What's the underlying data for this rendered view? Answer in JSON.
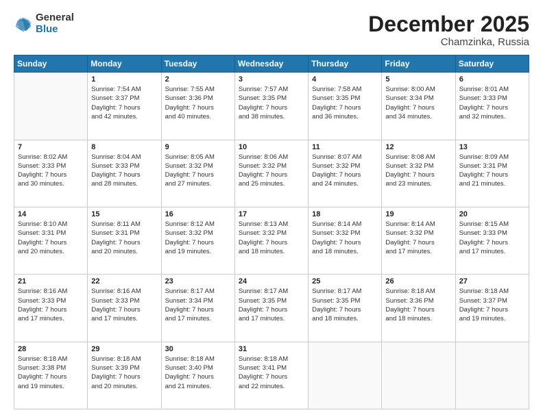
{
  "logo": {
    "general": "General",
    "blue": "Blue"
  },
  "header": {
    "month": "December 2025",
    "location": "Chamzinka, Russia"
  },
  "weekdays": [
    "Sunday",
    "Monday",
    "Tuesday",
    "Wednesday",
    "Thursday",
    "Friday",
    "Saturday"
  ],
  "weeks": [
    [
      {
        "day": "",
        "sunrise": "",
        "sunset": "",
        "daylight1": "",
        "daylight2": ""
      },
      {
        "day": "1",
        "sunrise": "Sunrise: 7:54 AM",
        "sunset": "Sunset: 3:37 PM",
        "daylight1": "Daylight: 7 hours",
        "daylight2": "and 42 minutes."
      },
      {
        "day": "2",
        "sunrise": "Sunrise: 7:55 AM",
        "sunset": "Sunset: 3:36 PM",
        "daylight1": "Daylight: 7 hours",
        "daylight2": "and 40 minutes."
      },
      {
        "day": "3",
        "sunrise": "Sunrise: 7:57 AM",
        "sunset": "Sunset: 3:35 PM",
        "daylight1": "Daylight: 7 hours",
        "daylight2": "and 38 minutes."
      },
      {
        "day": "4",
        "sunrise": "Sunrise: 7:58 AM",
        "sunset": "Sunset: 3:35 PM",
        "daylight1": "Daylight: 7 hours",
        "daylight2": "and 36 minutes."
      },
      {
        "day": "5",
        "sunrise": "Sunrise: 8:00 AM",
        "sunset": "Sunset: 3:34 PM",
        "daylight1": "Daylight: 7 hours",
        "daylight2": "and 34 minutes."
      },
      {
        "day": "6",
        "sunrise": "Sunrise: 8:01 AM",
        "sunset": "Sunset: 3:33 PM",
        "daylight1": "Daylight: 7 hours",
        "daylight2": "and 32 minutes."
      }
    ],
    [
      {
        "day": "7",
        "sunrise": "Sunrise: 8:02 AM",
        "sunset": "Sunset: 3:33 PM",
        "daylight1": "Daylight: 7 hours",
        "daylight2": "and 30 minutes."
      },
      {
        "day": "8",
        "sunrise": "Sunrise: 8:04 AM",
        "sunset": "Sunset: 3:33 PM",
        "daylight1": "Daylight: 7 hours",
        "daylight2": "and 28 minutes."
      },
      {
        "day": "9",
        "sunrise": "Sunrise: 8:05 AM",
        "sunset": "Sunset: 3:32 PM",
        "daylight1": "Daylight: 7 hours",
        "daylight2": "and 27 minutes."
      },
      {
        "day": "10",
        "sunrise": "Sunrise: 8:06 AM",
        "sunset": "Sunset: 3:32 PM",
        "daylight1": "Daylight: 7 hours",
        "daylight2": "and 25 minutes."
      },
      {
        "day": "11",
        "sunrise": "Sunrise: 8:07 AM",
        "sunset": "Sunset: 3:32 PM",
        "daylight1": "Daylight: 7 hours",
        "daylight2": "and 24 minutes."
      },
      {
        "day": "12",
        "sunrise": "Sunrise: 8:08 AM",
        "sunset": "Sunset: 3:32 PM",
        "daylight1": "Daylight: 7 hours",
        "daylight2": "and 23 minutes."
      },
      {
        "day": "13",
        "sunrise": "Sunrise: 8:09 AM",
        "sunset": "Sunset: 3:31 PM",
        "daylight1": "Daylight: 7 hours",
        "daylight2": "and 21 minutes."
      }
    ],
    [
      {
        "day": "14",
        "sunrise": "Sunrise: 8:10 AM",
        "sunset": "Sunset: 3:31 PM",
        "daylight1": "Daylight: 7 hours",
        "daylight2": "and 20 minutes."
      },
      {
        "day": "15",
        "sunrise": "Sunrise: 8:11 AM",
        "sunset": "Sunset: 3:31 PM",
        "daylight1": "Daylight: 7 hours",
        "daylight2": "and 20 minutes."
      },
      {
        "day": "16",
        "sunrise": "Sunrise: 8:12 AM",
        "sunset": "Sunset: 3:32 PM",
        "daylight1": "Daylight: 7 hours",
        "daylight2": "and 19 minutes."
      },
      {
        "day": "17",
        "sunrise": "Sunrise: 8:13 AM",
        "sunset": "Sunset: 3:32 PM",
        "daylight1": "Daylight: 7 hours",
        "daylight2": "and 18 minutes."
      },
      {
        "day": "18",
        "sunrise": "Sunrise: 8:14 AM",
        "sunset": "Sunset: 3:32 PM",
        "daylight1": "Daylight: 7 hours",
        "daylight2": "and 18 minutes."
      },
      {
        "day": "19",
        "sunrise": "Sunrise: 8:14 AM",
        "sunset": "Sunset: 3:32 PM",
        "daylight1": "Daylight: 7 hours",
        "daylight2": "and 17 minutes."
      },
      {
        "day": "20",
        "sunrise": "Sunrise: 8:15 AM",
        "sunset": "Sunset: 3:33 PM",
        "daylight1": "Daylight: 7 hours",
        "daylight2": "and 17 minutes."
      }
    ],
    [
      {
        "day": "21",
        "sunrise": "Sunrise: 8:16 AM",
        "sunset": "Sunset: 3:33 PM",
        "daylight1": "Daylight: 7 hours",
        "daylight2": "and 17 minutes."
      },
      {
        "day": "22",
        "sunrise": "Sunrise: 8:16 AM",
        "sunset": "Sunset: 3:33 PM",
        "daylight1": "Daylight: 7 hours",
        "daylight2": "and 17 minutes."
      },
      {
        "day": "23",
        "sunrise": "Sunrise: 8:17 AM",
        "sunset": "Sunset: 3:34 PM",
        "daylight1": "Daylight: 7 hours",
        "daylight2": "and 17 minutes."
      },
      {
        "day": "24",
        "sunrise": "Sunrise: 8:17 AM",
        "sunset": "Sunset: 3:35 PM",
        "daylight1": "Daylight: 7 hours",
        "daylight2": "and 17 minutes."
      },
      {
        "day": "25",
        "sunrise": "Sunrise: 8:17 AM",
        "sunset": "Sunset: 3:35 PM",
        "daylight1": "Daylight: 7 hours",
        "daylight2": "and 18 minutes."
      },
      {
        "day": "26",
        "sunrise": "Sunrise: 8:18 AM",
        "sunset": "Sunset: 3:36 PM",
        "daylight1": "Daylight: 7 hours",
        "daylight2": "and 18 minutes."
      },
      {
        "day": "27",
        "sunrise": "Sunrise: 8:18 AM",
        "sunset": "Sunset: 3:37 PM",
        "daylight1": "Daylight: 7 hours",
        "daylight2": "and 19 minutes."
      }
    ],
    [
      {
        "day": "28",
        "sunrise": "Sunrise: 8:18 AM",
        "sunset": "Sunset: 3:38 PM",
        "daylight1": "Daylight: 7 hours",
        "daylight2": "and 19 minutes."
      },
      {
        "day": "29",
        "sunrise": "Sunrise: 8:18 AM",
        "sunset": "Sunset: 3:39 PM",
        "daylight1": "Daylight: 7 hours",
        "daylight2": "and 20 minutes."
      },
      {
        "day": "30",
        "sunrise": "Sunrise: 8:18 AM",
        "sunset": "Sunset: 3:40 PM",
        "daylight1": "Daylight: 7 hours",
        "daylight2": "and 21 minutes."
      },
      {
        "day": "31",
        "sunrise": "Sunrise: 8:18 AM",
        "sunset": "Sunset: 3:41 PM",
        "daylight1": "Daylight: 7 hours",
        "daylight2": "and 22 minutes."
      },
      {
        "day": "",
        "sunrise": "",
        "sunset": "",
        "daylight1": "",
        "daylight2": ""
      },
      {
        "day": "",
        "sunrise": "",
        "sunset": "",
        "daylight1": "",
        "daylight2": ""
      },
      {
        "day": "",
        "sunrise": "",
        "sunset": "",
        "daylight1": "",
        "daylight2": ""
      }
    ]
  ]
}
